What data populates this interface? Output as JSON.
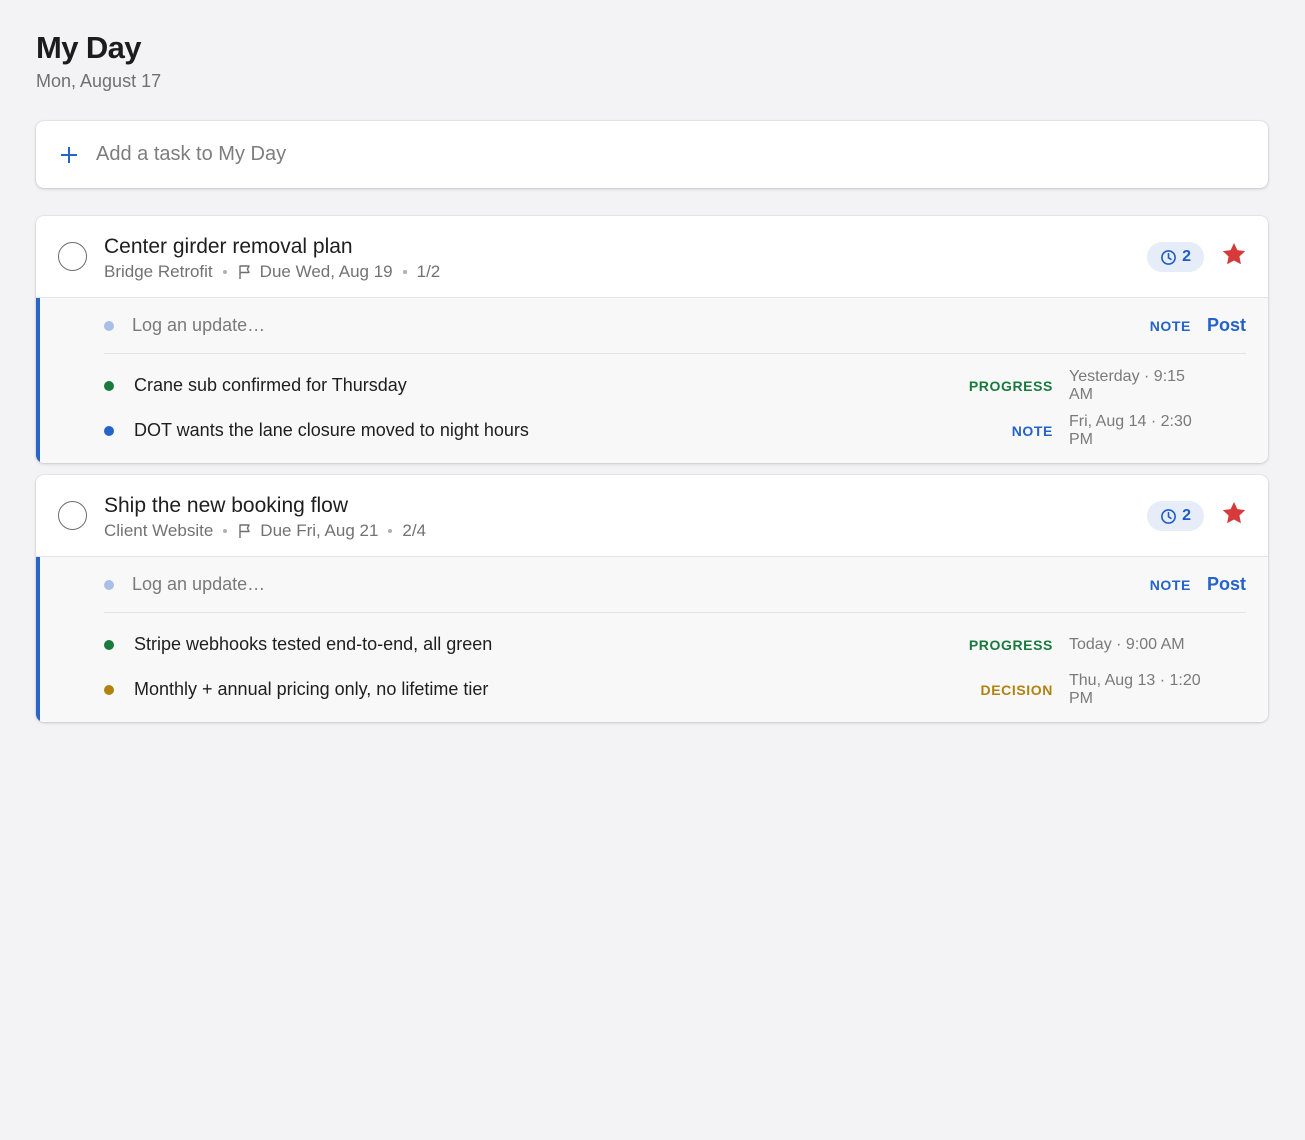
{
  "header": {
    "title": "My Day",
    "date": "Mon, August 17"
  },
  "add_task": {
    "placeholder": "Add a task to My Day"
  },
  "colors": {
    "accent": "#2563c9",
    "progress": "#1a7a3e",
    "note": "#2563c9",
    "decision": "#b0820f",
    "star": "#d63a3a"
  },
  "tasks": [
    {
      "title": "Center girder removal plan",
      "project": "Bridge Retrofit",
      "due": "Due Wed, Aug 19",
      "steps": "1/2",
      "update_count": "2",
      "starred": true,
      "log_placeholder": "Log an update…",
      "log_type": "NOTE",
      "post_label": "Post",
      "updates": [
        {
          "text": "Crane sub confirmed for Thursday",
          "type": "PROGRESS",
          "time": "Yesterday · 9:15 AM"
        },
        {
          "text": "DOT wants the lane closure moved to night hours",
          "type": "NOTE",
          "time": "Fri, Aug 14 · 2:30 PM"
        }
      ]
    },
    {
      "title": "Ship the new booking flow",
      "project": "Client Website",
      "due": "Due Fri, Aug 21",
      "steps": "2/4",
      "update_count": "2",
      "starred": true,
      "log_placeholder": "Log an update…",
      "log_type": "NOTE",
      "post_label": "Post",
      "updates": [
        {
          "text": "Stripe webhooks tested end-to-end, all green",
          "type": "PROGRESS",
          "time": "Today · 9:00 AM"
        },
        {
          "text": "Monthly + annual pricing only, no lifetime tier",
          "type": "DECISION",
          "time": "Thu, Aug 13 · 1:20 PM"
        }
      ]
    }
  ]
}
